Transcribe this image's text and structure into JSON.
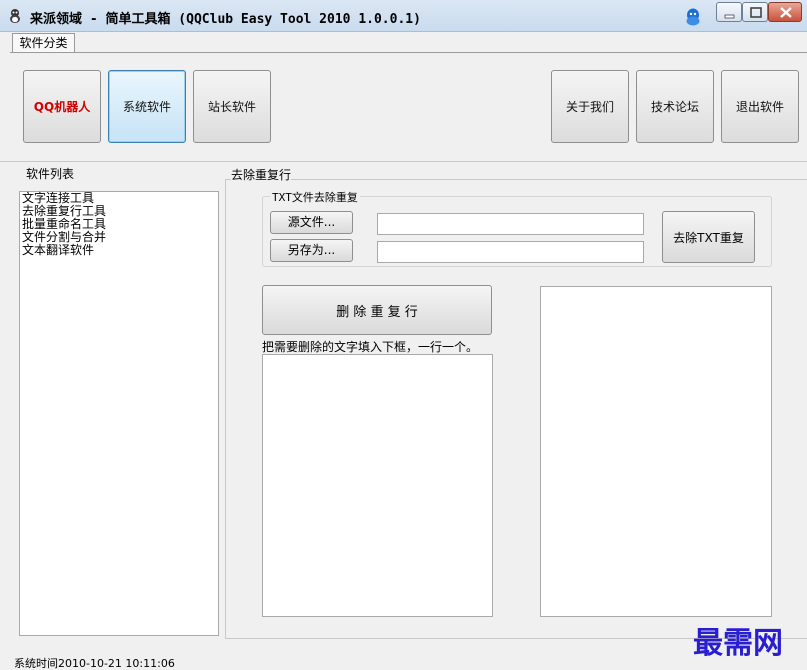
{
  "window": {
    "title": "来派领域 - 简单工具箱 (QQClub Easy Tool 2010 1.0.0.1)",
    "app_icon": "app-icon",
    "tray_icon": "qq-icon",
    "controls": [
      "minimize-icon",
      "maximize-icon",
      "close-icon"
    ]
  },
  "tabs": [
    {
      "label": "软件分类"
    }
  ],
  "categories": {
    "left": [
      {
        "label": "QQ机器人",
        "color": "#d40000"
      },
      {
        "label": "系统软件",
        "active": true
      },
      {
        "label": "站长软件"
      }
    ],
    "right": [
      {
        "label": "关于我们"
      },
      {
        "label": "技术论坛"
      },
      {
        "label": "退出软件"
      }
    ]
  },
  "software_list": {
    "title": "软件列表",
    "items": [
      "文字连接工具",
      "去除重复行工具",
      "批量重命名工具",
      "文件分割与合并",
      "文本翻译软件"
    ]
  },
  "dedupe": {
    "title": "去除重复行",
    "txt_group": {
      "title": "TXT文件去除重复",
      "source_button": "源文件...",
      "source_value": "",
      "saveas_button": "另存为...",
      "saveas_value": "",
      "run_button": "去除TXT重复"
    },
    "delete_button": "删 除 重 复 行",
    "hint": "把需要删除的文字填入下框，一行一个。",
    "input_text": "",
    "output_text": ""
  },
  "status": {
    "text": "系统时间2010-10-21 10:11:06"
  },
  "watermark": "最需网"
}
